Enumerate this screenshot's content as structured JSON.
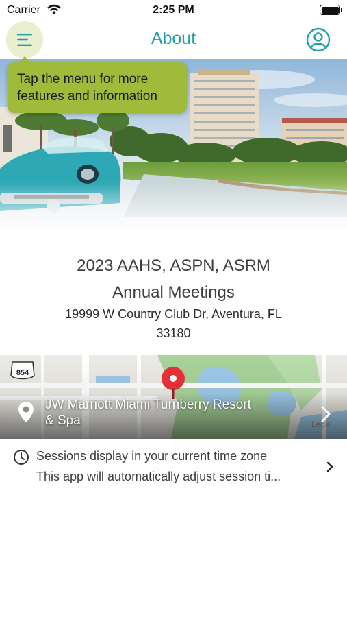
{
  "status_bar": {
    "carrier": "Carrier",
    "time": "2:25 PM"
  },
  "nav": {
    "title": "About",
    "menu_icon": "hamburger-menu-icon",
    "profile_icon": "user-circle-icon",
    "accent_color": "#1f9ea8"
  },
  "tooltip": {
    "text_line1": "Tap the menu for more",
    "text_line2": "features and information",
    "color": "#9fbb3a"
  },
  "event": {
    "title_line1": "2023 AAHS, ASPN, ASRM",
    "title_line2": "Annual Meetings",
    "address_line1": "19999 W Country Club Dr, Aventura, FL",
    "address_line2": "33180"
  },
  "map": {
    "venue_line1": "JW Marriott Miami Turnberry Resort",
    "venue_line2": "& Spa",
    "road_shield": "854",
    "legal": "Legal",
    "pin_icon": "location-pin-icon",
    "chevron_icon": "chevron-right-icon"
  },
  "timezone": {
    "title": "Sessions display in your current time zone",
    "subtitle": "This app will automatically adjust session ti...",
    "icon": "clock-icon"
  }
}
